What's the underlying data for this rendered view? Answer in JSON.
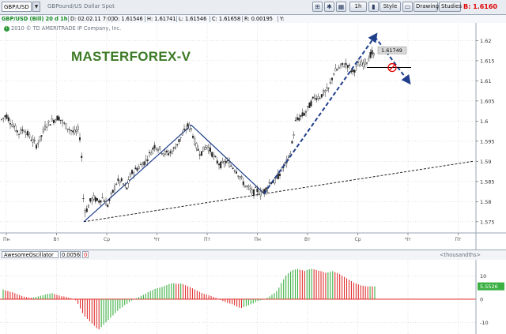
{
  "toolbar": {
    "symbol": "GBP/USD",
    "description": "GBPound/US Dollar Spot",
    "period_button": "1h",
    "style_button": "Style",
    "drawings_button": "Drawings",
    "studies_button": "Studies",
    "last_price": "B: 1.6160",
    "icons": [
      "chart-type-icon",
      "gear-icon",
      "grid-icon",
      "bars-icon",
      "monitor-icon",
      "flask-icon"
    ]
  },
  "quote": {
    "label": "GBP/USD (Bill) 20 d 1h",
    "date": "D: 02.02.11 7:00",
    "open": "O: 1.61546",
    "high": "H: 1.61741",
    "low": "L: 1.61546",
    "close": "C: 1.61658",
    "range": "R: 0.00195",
    "y": "Y:"
  },
  "copyright": "2010 © TD AMERITRADE IP Company, Inc.",
  "watermark": "MASTERFOREX-V",
  "price_tag": "1.61749",
  "chart_data": [
    {
      "type": "candlestick",
      "title": "GBP/USD (Bill) 20 d 1h",
      "y_ticks": [
        "1.62",
        "1.615",
        "1.61",
        "1.605",
        "1.6",
        "1.595",
        "1.59",
        "1.585",
        "1.58",
        "1.575"
      ],
      "ylim": [
        1.573,
        1.624
      ],
      "x_ticks": [
        "Пн",
        "Вт",
        "Ср",
        "Чт",
        "Пт",
        "Пн",
        "Вт",
        "Ср",
        "Чт",
        "Пт"
      ],
      "grid": true,
      "last_value": 1.61749,
      "price_path": [
        [
          0,
          1.6
        ],
        [
          8,
          1.6015
        ],
        [
          16,
          1.599
        ],
        [
          24,
          1.597
        ],
        [
          30,
          1.598
        ],
        [
          38,
          1.596
        ],
        [
          46,
          1.594
        ],
        [
          52,
          1.596
        ],
        [
          58,
          1.599
        ],
        [
          66,
          1.6
        ],
        [
          74,
          1.601
        ],
        [
          82,
          1.599
        ],
        [
          88,
          1.598
        ],
        [
          94,
          1.597
        ],
        [
          100,
          1.598
        ],
        [
          103,
          1.592
        ],
        [
          106,
          1.578
        ],
        [
          110,
          1.578
        ],
        [
          114,
          1.58
        ],
        [
          118,
          1.581
        ],
        [
          124,
          1.58
        ],
        [
          130,
          1.581
        ],
        [
          136,
          1.579
        ],
        [
          142,
          1.582
        ],
        [
          148,
          1.585
        ],
        [
          154,
          1.585
        ],
        [
          160,
          1.583
        ],
        [
          166,
          1.587
        ],
        [
          172,
          1.588
        ],
        [
          178,
          1.589
        ],
        [
          184,
          1.59
        ],
        [
          190,
          1.592
        ],
        [
          196,
          1.594
        ],
        [
          202,
          1.593
        ],
        [
          208,
          1.592
        ],
        [
          214,
          1.592
        ],
        [
          220,
          1.593
        ],
        [
          226,
          1.595
        ],
        [
          232,
          1.597
        ],
        [
          238,
          1.599
        ],
        [
          242,
          1.598
        ],
        [
          246,
          1.595
        ],
        [
          250,
          1.593
        ],
        [
          254,
          1.592
        ],
        [
          258,
          1.593
        ],
        [
          262,
          1.594
        ],
        [
          268,
          1.592
        ],
        [
          274,
          1.59
        ],
        [
          280,
          1.589
        ],
        [
          286,
          1.59
        ],
        [
          292,
          1.589
        ],
        [
          298,
          1.588
        ],
        [
          304,
          1.586
        ],
        [
          310,
          1.584
        ],
        [
          316,
          1.583
        ],
        [
          320,
          1.582
        ],
        [
          324,
          1.583
        ],
        [
          330,
          1.582
        ],
        [
          336,
          1.583
        ],
        [
          342,
          1.585
        ],
        [
          348,
          1.585
        ],
        [
          354,
          1.587
        ],
        [
          360,
          1.589
        ],
        [
          366,
          1.591
        ],
        [
          370,
          1.595
        ],
        [
          374,
          1.6
        ],
        [
          380,
          1.601
        ],
        [
          386,
          1.602
        ],
        [
          392,
          1.604
        ],
        [
          398,
          1.606
        ],
        [
          404,
          1.606
        ],
        [
          410,
          1.607
        ],
        [
          416,
          1.608
        ],
        [
          422,
          1.612
        ],
        [
          428,
          1.613
        ],
        [
          434,
          1.614
        ],
        [
          440,
          1.614
        ],
        [
          446,
          1.612
        ],
        [
          452,
          1.614
        ],
        [
          458,
          1.614
        ],
        [
          464,
          1.615
        ],
        [
          470,
          1.617
        ],
        [
          474,
          1.616
        ]
      ],
      "annotations": [
        {
          "kind": "trendline",
          "style": "dashed",
          "color": "#222222",
          "from": [
            106,
            1.575
          ],
          "to": [
            598,
            1.59
          ]
        },
        {
          "kind": "wedge",
          "style": "solid",
          "color": "#1f3e8c",
          "points": [
            [
              106,
              1.575
            ],
            [
              242,
              1.599
            ],
            [
              334,
              1.582
            ]
          ]
        },
        {
          "kind": "forecast-arrow",
          "style": "dashed",
          "color": "#1f3e8c",
          "from": [
            334,
            1.582
          ],
          "to": [
            474,
            1.621
          ]
        },
        {
          "kind": "forecast-arrow",
          "style": "dashed",
          "color": "#1f3e8c",
          "from": [
            474,
            1.621
          ],
          "to": [
            516,
            1.61
          ]
        },
        {
          "kind": "level",
          "style": "solid",
          "color": "#000000",
          "from": [
            464,
            1.6133
          ],
          "to": [
            520,
            1.6133
          ]
        },
        {
          "kind": "circle-marker",
          "color": "#e00000",
          "at": [
            496,
            1.6133
          ]
        }
      ]
    },
    {
      "type": "bar",
      "title": "AwesomeOscillator",
      "value_label": "0.0056",
      "param": "0",
      "units": "<thousandths>",
      "y_ticks": [
        "10",
        "0",
        "-10"
      ],
      "ylim": [
        -14,
        16
      ],
      "last_value": "5.5526",
      "up_color": "#3cb043",
      "down_color": "#e03030",
      "values": [
        4.2,
        3.8,
        3.5,
        3.2,
        3.0,
        2.6,
        2.2,
        1.8,
        1.4,
        1.1,
        0.9,
        0.7,
        0.6,
        0.8,
        1.0,
        1.2,
        1.5,
        1.7,
        2.0,
        2.3,
        2.4,
        2.6,
        2.2,
        1.9,
        1.6,
        1.3,
        1.2,
        1.0,
        0.7,
        0.4,
        0.2,
        -0.5,
        -2,
        -4,
        -6,
        -7.5,
        -8.5,
        -9.5,
        -10.5,
        -11.5,
        -12.5,
        -13,
        -12,
        -11,
        -10,
        -9,
        -8,
        -7,
        -6,
        -5,
        -4,
        -3.5,
        -2.5,
        -2,
        -1.2,
        -0.6,
        -0.1,
        0.4,
        0.9,
        1.4,
        1.9,
        2.4,
        3.0,
        3.5,
        4.0,
        4.5,
        4.8,
        5.0,
        5.3,
        5.7,
        6.1,
        6.5,
        6.8,
        6.9,
        6.7,
        6.6,
        6.8,
        6.5,
        6.0,
        5.6,
        5.2,
        4.7,
        4.2,
        3.7,
        3.2,
        2.7,
        2.3,
        2.0,
        1.7,
        1.4,
        1.0,
        0.6,
        0.2,
        -0.3,
        -0.8,
        -1.2,
        -1.6,
        -1.9,
        -2.2,
        -2.6,
        -3.2,
        -3.6,
        -3.8,
        -3.4,
        -3.0,
        -2.6,
        -2.2,
        -1.8,
        -1.3,
        -0.8,
        -0.5,
        -0.3,
        0.1,
        0.6,
        1.2,
        1.9,
        2.6,
        3.5,
        5.0,
        7.0,
        8.6,
        10.2,
        11.2,
        12.0,
        12.6,
        12.8,
        13.0,
        12.7,
        12.5,
        12.2,
        12.6,
        12.9,
        13.1,
        12.9,
        12.6,
        12.3,
        12.1,
        11.8,
        11.4,
        11.6,
        11.9,
        12.1,
        11.7,
        11.3,
        10.8,
        10.2,
        9.6,
        9.0,
        8.4,
        7.8,
        7.2,
        6.8,
        6.4,
        6.0,
        5.8,
        5.6,
        5.5,
        5.6,
        5.5,
        5.6
      ]
    }
  ]
}
